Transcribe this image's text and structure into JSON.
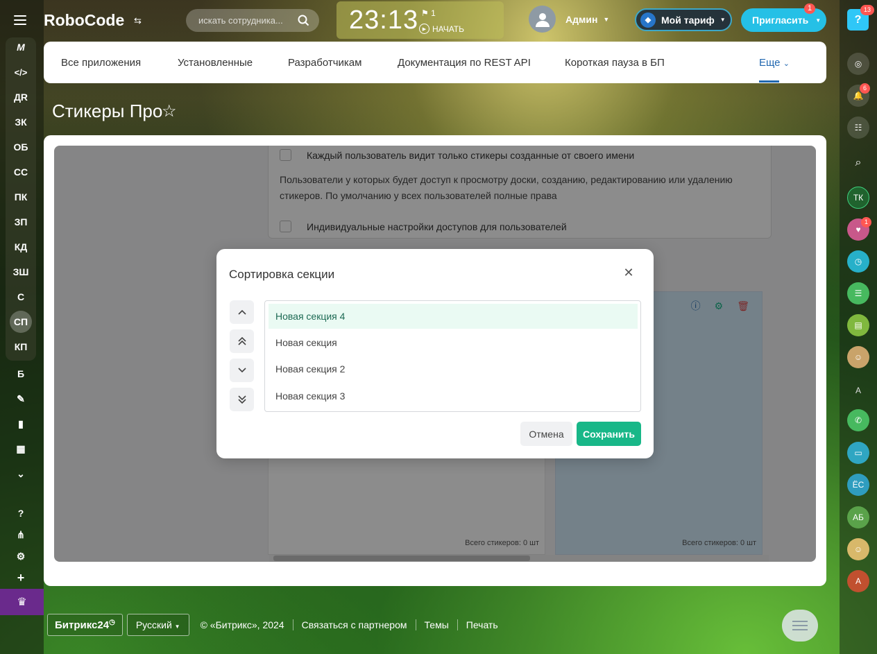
{
  "header": {
    "logo": "RoboCode",
    "search_placeholder": "искать сотрудника...",
    "clock_time": "23:13",
    "clock_flags": "1",
    "clock_start": "НАЧАТЬ",
    "user_name": "Админ",
    "tarif_label": "Мой тариф",
    "invite_label": "Пригласить",
    "invite_badge": "1"
  },
  "left_menu": {
    "items": [
      "ДR",
      "ЗК",
      "ОБ",
      "СС",
      "ПК",
      "ЗП",
      "КД",
      "ЗШ",
      "С",
      "СП",
      "КП",
      "Б"
    ]
  },
  "right_bar": {
    "help_badge": "13",
    "notif_badge": "6",
    "chat_badge": "1",
    "avatars": [
      "ТК",
      "А",
      "ЁС",
      "АБ",
      "А"
    ]
  },
  "topnav": {
    "items": [
      "Все приложения",
      "Установленные",
      "Разработчикам",
      "Документация по REST API",
      "Короткая пауза в БП"
    ],
    "more": "Еще"
  },
  "page": {
    "title": "Стикеры Про"
  },
  "settings": {
    "row1": "Каждый пользователь видит только стикеры созданные от своего имени",
    "text": "Пользователи у которых будет доступ к просмотру доски, созданию, редактированию или удалению стикеров. По умолчанию у всех пользователей полные права",
    "row2": "Индивидуальные настройки доступов для пользователей"
  },
  "columns": {
    "count1": "Всего стикеров: 0 шт",
    "count2": "Всего стикеров: 0 шт"
  },
  "modal": {
    "title": "Сортировка секции",
    "sections": [
      "Новая секция 4",
      "Новая секция",
      "Новая секция 2",
      "Новая секция 3"
    ],
    "cancel": "Отмена",
    "save": "Сохранить"
  },
  "footer": {
    "logo": "Битрикс24",
    "lang": "Русский",
    "copyright": "© «Битрикс», 2024",
    "links": [
      "Связаться с партнером",
      "Темы",
      "Печать"
    ]
  },
  "colors": {
    "accent_green": "#18b788",
    "accent_blue": "#2067b0",
    "invite_blue": "#25c0e6"
  }
}
